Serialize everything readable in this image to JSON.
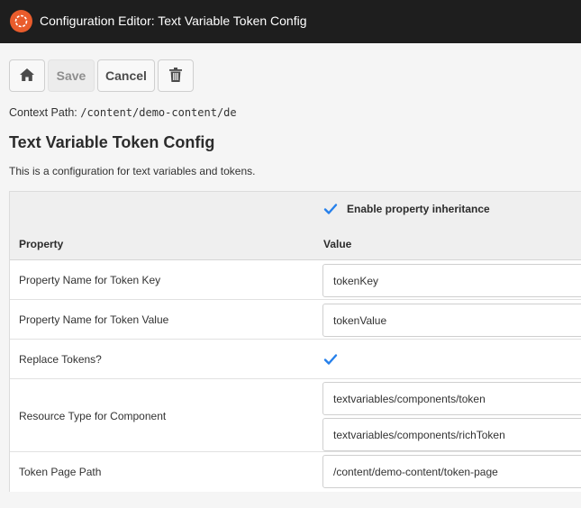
{
  "header": {
    "title": "Configuration Editor: Text Variable Token Config",
    "logo_icon": "aem-logo-icon",
    "accent": "#e95c2c"
  },
  "toolbar": {
    "home_icon": "home-icon",
    "save_label": "Save",
    "cancel_label": "Cancel",
    "delete_icon": "trash-icon"
  },
  "context": {
    "label": "Context Path:",
    "path": "/content/demo-content/de"
  },
  "page": {
    "title": "Text Variable Token Config",
    "description": "This is a configuration for text variables and tokens."
  },
  "table": {
    "inherit_label": "Enable property inheritance",
    "inherit_checked": true,
    "columns": [
      "Property",
      "Value"
    ],
    "rows": [
      {
        "property": "Property Name for Token Key",
        "values": [
          "tokenKey"
        ]
      },
      {
        "property": "Property Name for Token Value",
        "values": [
          "tokenValue"
        ]
      },
      {
        "property": "Replace Tokens?",
        "checked": true
      },
      {
        "property": "Resource Type for Component",
        "values": [
          "textvariables/components/token",
          "textvariables/components/richToken"
        ]
      },
      {
        "property": "Token Page Path",
        "values": [
          "/content/demo-content/token-page"
        ]
      }
    ]
  },
  "colors": {
    "checkbox": "#2680eb",
    "header_bg": "#1e1e1e"
  }
}
